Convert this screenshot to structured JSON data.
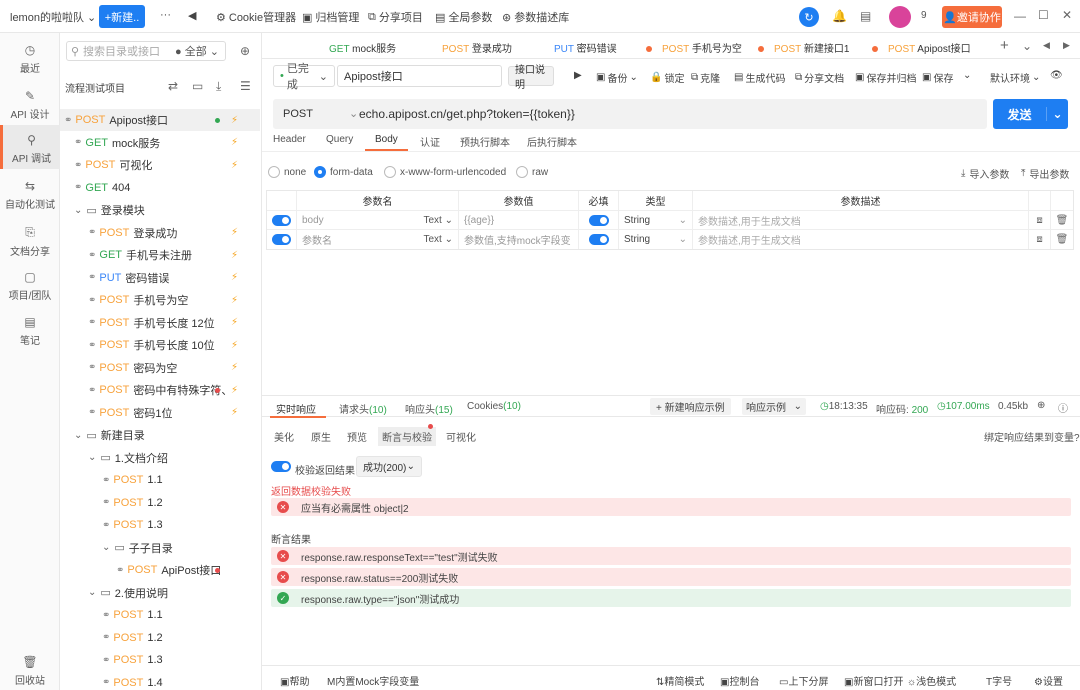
{
  "topbar": {
    "team": "lemon的啦啦队",
    "new_label": "+新建..",
    "items": [
      "Cookie管理器",
      "归档管理",
      "分享项目",
      "全局参数",
      "参数描述库"
    ],
    "notify_count": "9",
    "invite_label": "邀请协作"
  },
  "rail": {
    "items": [
      "最近",
      "API 设计",
      "API 调试",
      "自动化测试",
      "文档分享",
      "项目/团队",
      "笔记"
    ],
    "bottom": "回收站"
  },
  "tree": {
    "search_placeholder": "搜索目录或接口",
    "filter": "全部",
    "title": "流程测试项目",
    "rows": [
      {
        "method": "POST",
        "name": "Apipost接口"
      },
      {
        "method": "GET",
        "name": "mock服务"
      },
      {
        "method": "POST",
        "name": "可视化"
      },
      {
        "method": "GET",
        "name": "404"
      },
      {
        "method": "",
        "name": "登录模块"
      },
      {
        "method": "POST",
        "name": "登录成功"
      },
      {
        "method": "GET",
        "name": "手机号未注册"
      },
      {
        "method": "PUT",
        "name": "密码错误"
      },
      {
        "method": "POST",
        "name": "手机号为空"
      },
      {
        "method": "POST",
        "name": "手机号长度 12位"
      },
      {
        "method": "POST",
        "name": "手机号长度 10位"
      },
      {
        "method": "POST",
        "name": "密码为空"
      },
      {
        "method": "POST",
        "name": "密码中有特殊字符、"
      },
      {
        "method": "POST",
        "name": "密码1位"
      },
      {
        "method": "",
        "name": "新建目录"
      },
      {
        "method": "",
        "name": "1.文档介绍"
      },
      {
        "method": "POST",
        "name": "1.1"
      },
      {
        "method": "POST",
        "name": "1.2"
      },
      {
        "method": "POST",
        "name": "1.3"
      },
      {
        "method": "",
        "name": "子子目录"
      },
      {
        "method": "POST",
        "name": "ApiPost接口"
      },
      {
        "method": "",
        "name": "2.使用说明"
      },
      {
        "method": "POST",
        "name": "1.1"
      },
      {
        "method": "POST",
        "name": "1.2"
      },
      {
        "method": "POST",
        "name": "1.3"
      },
      {
        "method": "POST",
        "name": "1.4"
      }
    ]
  },
  "tabs": [
    {
      "method": "GET",
      "name": "mock服务"
    },
    {
      "method": "POST",
      "name": "登录成功"
    },
    {
      "method": "PUT",
      "name": "密码错误"
    },
    {
      "method": "POST",
      "name": "手机号为空"
    },
    {
      "method": "POST",
      "name": "新建接口1"
    },
    {
      "method": "POST",
      "name": "Apipost接口"
    }
  ],
  "toolbar": {
    "status": "已完成",
    "api_name": "Apipost接口",
    "doc_btn": "接口说明",
    "items": [
      "备份",
      "锁定",
      "克隆",
      "生成代码",
      "分享文档",
      "保存并归档",
      "保存"
    ],
    "env": "默认环境"
  },
  "request": {
    "method": "POST",
    "url": "echo.apipost.cn/get.php?token={{token}}",
    "send": "发送",
    "subtabs": [
      "Header",
      "Query",
      "Body",
      "认证",
      "预执行脚本",
      "后执行脚本"
    ],
    "body_types": [
      "none",
      "form-data",
      "x-www-form-urlencoded",
      "raw"
    ],
    "import_label": "导入参数",
    "export_label": "导出参数"
  },
  "params": {
    "headers": [
      "参数名",
      "参数值",
      "必填",
      "类型",
      "参数描述"
    ],
    "rows": [
      {
        "name": "body",
        "ftype": "Text",
        "value": "{{age}}",
        "type": "String",
        "desc": "参数描述,用于生成文档"
      },
      {
        "name": "参数名",
        "ftype": "Text",
        "value": "参数值,支持mock字段变",
        "type": "String",
        "desc": "参数描述,用于生成文档"
      }
    ]
  },
  "response": {
    "tabs": [
      "实时响应",
      "请求头",
      "响应头",
      "Cookies"
    ],
    "counts": [
      "(10)",
      "(15)",
      "(10)"
    ],
    "new_example": "+ 新建响应示例",
    "example": "响应示例",
    "time": "18:13:35",
    "code_label": "响应码:",
    "code": "200",
    "duration": "107.00ms",
    "size": "0.45kb",
    "subtabs": [
      "美化",
      "原生",
      "预览",
      "断言与校验",
      "可视化"
    ],
    "bind_label": "绑定响应结果到变量?",
    "verify_label": "校验返回结果",
    "verify_select": "成功(200)",
    "fail_title": "返回数据校验失败",
    "fail_row": "应当有必需属性 object|2",
    "assert_title": "断言结果",
    "asserts": [
      {
        "text": "response.raw.responseText==\"test\"测试失败",
        "ok": false
      },
      {
        "text": "response.raw.status==200测试失败",
        "ok": false
      },
      {
        "text": "response.raw.type==\"json\"测试成功",
        "ok": true
      }
    ]
  },
  "bottombar": {
    "left": [
      "帮助",
      "内置Mock字段变量"
    ],
    "right": [
      "精简模式",
      "控制台",
      "上下分屏",
      "新窗口打开",
      "浅色模式",
      "字号",
      "设置"
    ]
  },
  "colors": {
    "primary": "#1e7ef2",
    "accent": "#f56d3c",
    "post": "#f7a23c",
    "get": "#33a753",
    "put": "#3a86f7"
  }
}
